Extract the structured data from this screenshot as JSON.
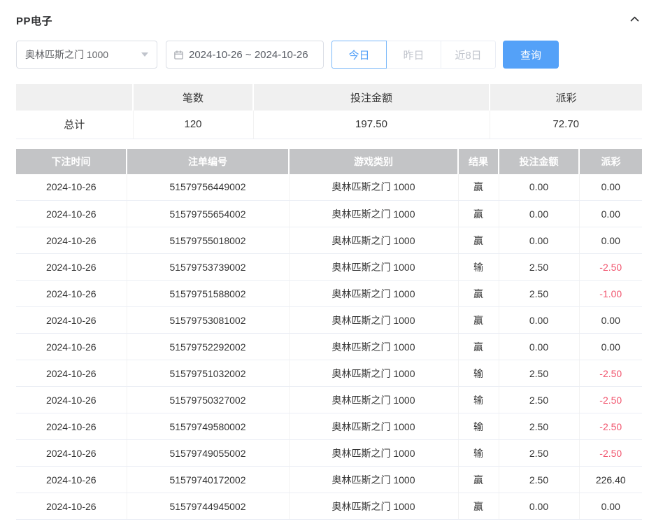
{
  "colors": {
    "accent": "#54a1f8",
    "negative": "#f1556e",
    "table_header_bg": "#c3c4c6"
  },
  "header": {
    "title": "PP电子"
  },
  "filters": {
    "game_select": {
      "value": "奥林匹斯之门 1000"
    },
    "date_range": {
      "value": "2024-10-26 ~ 2024-10-26"
    },
    "quick_buttons": [
      {
        "label": "今日",
        "active": true
      },
      {
        "label": "昨日",
        "active": false
      },
      {
        "label": "近8日",
        "active": false
      }
    ],
    "search_button": "查询"
  },
  "summary": {
    "columns": [
      "笔数",
      "投注金额",
      "派彩"
    ],
    "total_label": "总计",
    "count": "120",
    "bet_amount": "197.50",
    "payout": "72.70"
  },
  "table": {
    "columns": [
      "下注时间",
      "注单编号",
      "游戏类别",
      "结果",
      "投注金额",
      "派彩"
    ],
    "rows": [
      {
        "time": "2024-10-26",
        "bet_id": "51579756449002",
        "game": "奥林匹斯之门 1000",
        "result": "赢",
        "amount": "0.00",
        "payout": "0.00"
      },
      {
        "time": "2024-10-26",
        "bet_id": "51579755654002",
        "game": "奥林匹斯之门 1000",
        "result": "赢",
        "amount": "0.00",
        "payout": "0.00"
      },
      {
        "time": "2024-10-26",
        "bet_id": "51579755018002",
        "game": "奥林匹斯之门 1000",
        "result": "赢",
        "amount": "0.00",
        "payout": "0.00"
      },
      {
        "time": "2024-10-26",
        "bet_id": "51579753739002",
        "game": "奥林匹斯之门 1000",
        "result": "输",
        "amount": "2.50",
        "payout": "-2.50"
      },
      {
        "time": "2024-10-26",
        "bet_id": "51579751588002",
        "game": "奥林匹斯之门 1000",
        "result": "赢",
        "amount": "2.50",
        "payout": "-1.00"
      },
      {
        "time": "2024-10-26",
        "bet_id": "51579753081002",
        "game": "奥林匹斯之门 1000",
        "result": "赢",
        "amount": "0.00",
        "payout": "0.00"
      },
      {
        "time": "2024-10-26",
        "bet_id": "51579752292002",
        "game": "奥林匹斯之门 1000",
        "result": "赢",
        "amount": "0.00",
        "payout": "0.00"
      },
      {
        "time": "2024-10-26",
        "bet_id": "51579751032002",
        "game": "奥林匹斯之门 1000",
        "result": "输",
        "amount": "2.50",
        "payout": "-2.50"
      },
      {
        "time": "2024-10-26",
        "bet_id": "51579750327002",
        "game": "奥林匹斯之门 1000",
        "result": "输",
        "amount": "2.50",
        "payout": "-2.50"
      },
      {
        "time": "2024-10-26",
        "bet_id": "51579749580002",
        "game": "奥林匹斯之门 1000",
        "result": "输",
        "amount": "2.50",
        "payout": "-2.50"
      },
      {
        "time": "2024-10-26",
        "bet_id": "51579749055002",
        "game": "奥林匹斯之门 1000",
        "result": "输",
        "amount": "2.50",
        "payout": "-2.50"
      },
      {
        "time": "2024-10-26",
        "bet_id": "51579740172002",
        "game": "奥林匹斯之门 1000",
        "result": "赢",
        "amount": "2.50",
        "payout": "226.40"
      },
      {
        "time": "2024-10-26",
        "bet_id": "51579744945002",
        "game": "奥林匹斯之门 1000",
        "result": "赢",
        "amount": "0.00",
        "payout": "0.00"
      }
    ]
  }
}
